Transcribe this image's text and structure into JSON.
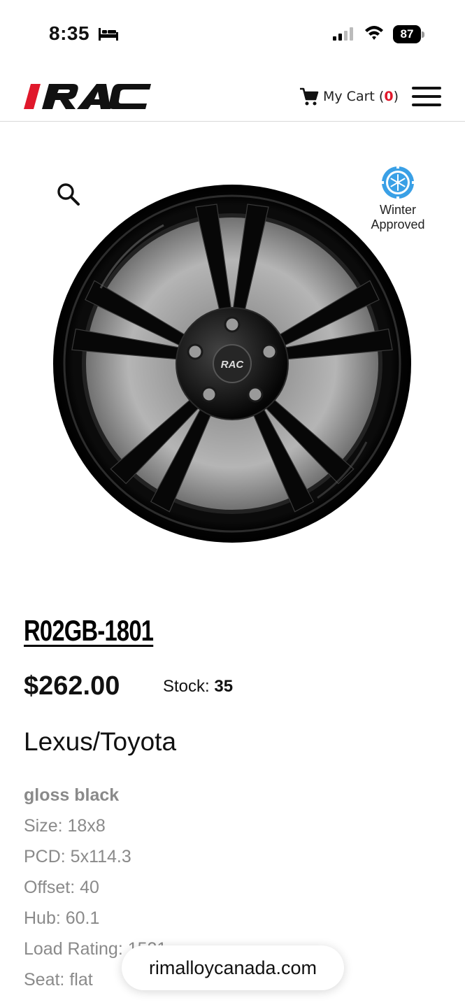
{
  "status_bar": {
    "time": "8:35",
    "battery": "87"
  },
  "header": {
    "logo_text": "RAC",
    "cart_label": "My Cart",
    "cart_count_open": "(",
    "cart_count": "0",
    "cart_count_close": ")"
  },
  "badge": {
    "line1": "Winter",
    "line2": "Approved"
  },
  "product": {
    "sku": "R02GB-1801",
    "price": "$262.00",
    "stock_label": "Stock:",
    "stock_value": "35",
    "brand": "Lexus/Toyota",
    "wheel_center_logo": "RAC",
    "specs": [
      "gloss black",
      "Size: 18x8",
      "PCD: 5x114.3",
      "Offset: 40",
      "Hub: 60.1",
      "Load Rating: 1521",
      "Seat: flat"
    ]
  },
  "browser": {
    "url": "rimalloycanada.com"
  },
  "colors": {
    "accent_red": "#e0182b",
    "badge_blue": "#3aa0e6",
    "spec_gray": "#8a8a8a"
  },
  "icons": [
    "bed-icon",
    "signal-icon",
    "wifi-icon",
    "cart-icon",
    "menu-icon",
    "search-icon",
    "snowflake-icon"
  ]
}
